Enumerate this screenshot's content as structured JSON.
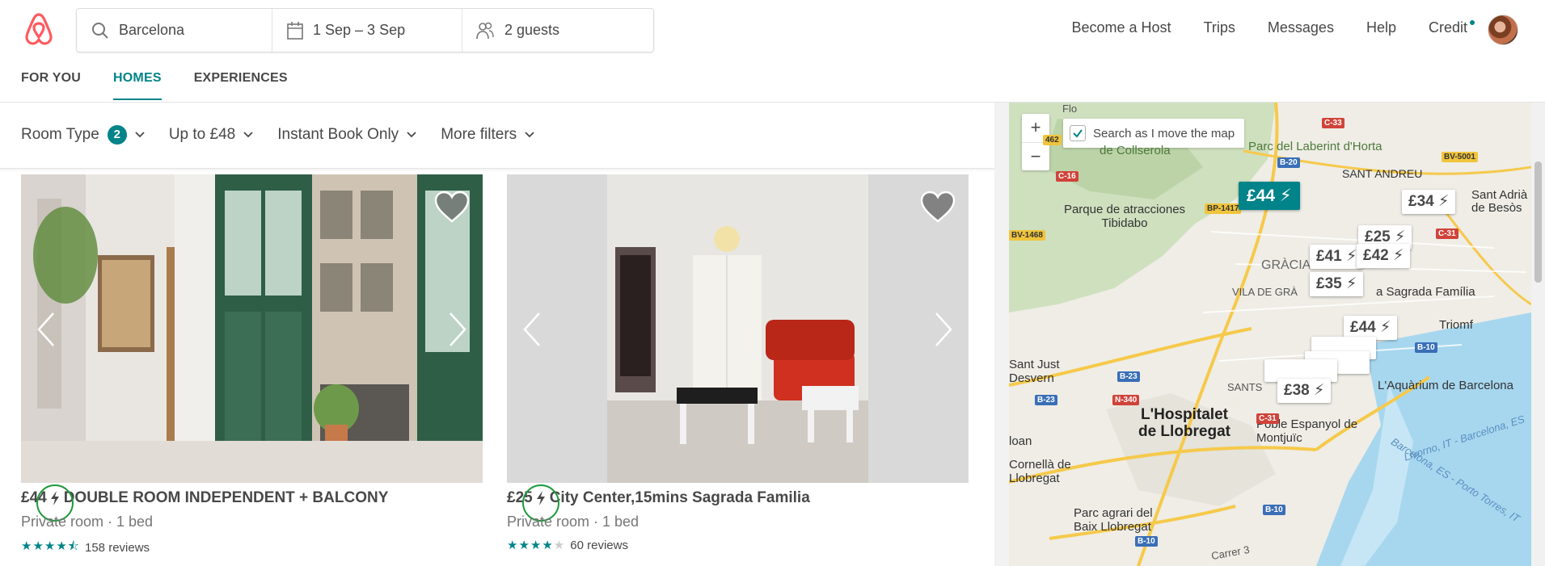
{
  "header": {
    "search": {
      "location": "Barcelona",
      "dates": "1 Sep – 3 Sep",
      "guests": "2 guests"
    },
    "nav": {
      "become_host": "Become a Host",
      "trips": "Trips",
      "messages": "Messages",
      "help": "Help",
      "credit": "Credit"
    },
    "brand_color": "#FF5A5F"
  },
  "tabs": {
    "for_you": "FOR YOU",
    "homes": "HOMES",
    "experiences": "EXPERIENCES",
    "active": "HOMES"
  },
  "filters": {
    "room_type": "Room Type",
    "room_type_count": "2",
    "price": "Up to £48",
    "instant_book": "Instant Book Only",
    "more": "More filters"
  },
  "listings": [
    {
      "price": "£44",
      "title": "DOUBLE ROOM INDEPENDENT + BALCONY",
      "details": "Private room · 1 bed",
      "rating": 4.5,
      "reviews": "158 reviews",
      "instant_book": true
    },
    {
      "price": "£25",
      "title": "City Center,15mins Sagrada Familia",
      "details": "Private room · 1 bed",
      "rating": 4,
      "reviews": "60 reviews",
      "instant_book": true
    }
  ],
  "map": {
    "search_as_move": "Search as I move the map",
    "search_as_move_checked": true,
    "zoom_in": "+",
    "zoom_out": "−",
    "pins": [
      "£34",
      "£44",
      "£25",
      "£41",
      "£42",
      "£35",
      "£44",
      "£38"
    ],
    "selected_pin": "£44",
    "labels": {
      "collserola": "de Collserola",
      "laberint": "Parc del Laberint d'Horta",
      "sant_andreu": "SANT ANDREU",
      "sant_adria": "Sant Adrià de Besòs",
      "tibidabo": "Parque de atracciones Tibidabo",
      "gracia": "GRÀCIA",
      "vila_de_gracia": "VILA DE GRÀ",
      "sagrada": "a Sagrada Família",
      "triomf": "Triomf",
      "sant_just": "Sant Just Desvern",
      "sants": "SANTS",
      "aquarium": "L'Aquàrium de Barcelona",
      "hospitalet": "L'Hospitalet de Llobregat",
      "poble": "Poble Espanyol de Montjuïc",
      "cornella": "Cornellà de Llobregat",
      "baix": "Parc agrari del Baix Llobregat",
      "ioan": "loan",
      "livorno": "Livorno, IT - Barcelona, ES",
      "porto": "Barcelona, ES - Porto Torres, IT",
      "carrer": "Carrer 3",
      "flo": "Flo"
    },
    "roads": [
      "C-33",
      "B-20",
      "BV-5001",
      "C-16",
      "BP-1417",
      "BV-1468",
      "C-31",
      "B-10",
      "B-23",
      "N-340",
      "C-31",
      "B-10",
      "B-23",
      "B-10",
      "462"
    ]
  },
  "colors": {
    "accent": "#008489",
    "star": "#008489",
    "annotation_circle": "#1e9a3c"
  }
}
